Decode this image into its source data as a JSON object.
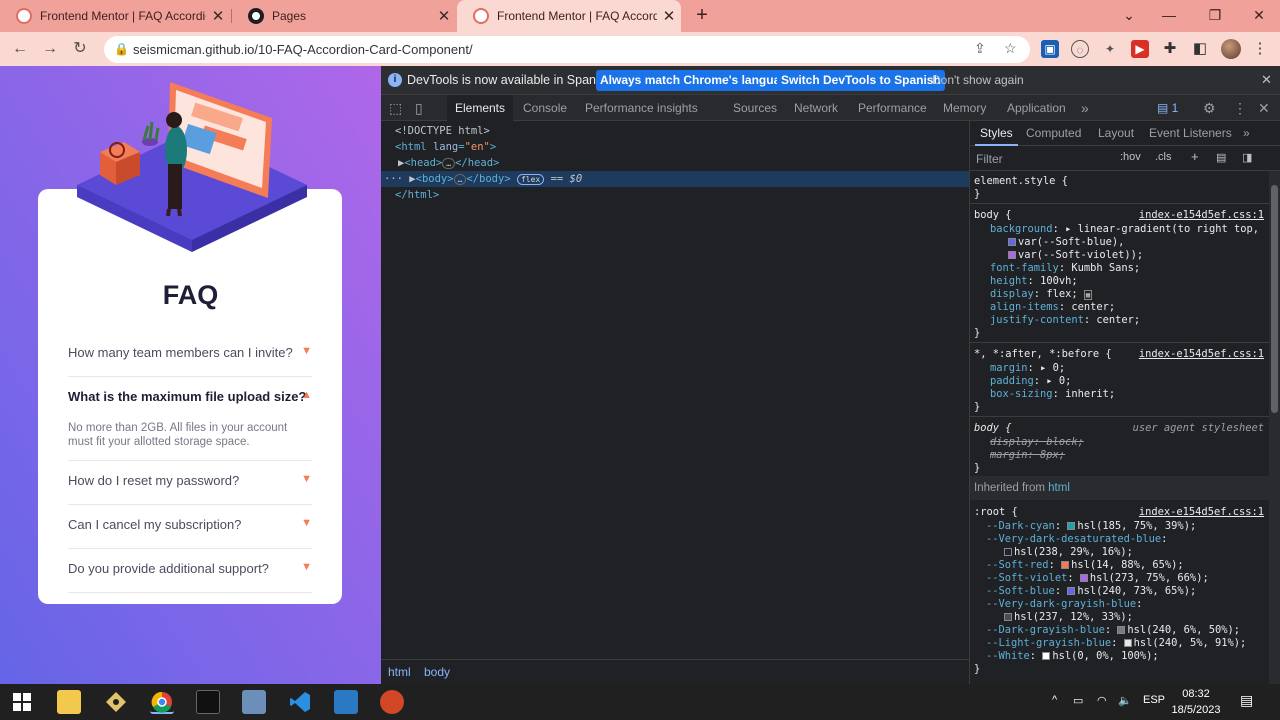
{
  "browser": {
    "tabs": [
      {
        "title": "Frontend Mentor | FAQ Accordion Card"
      },
      {
        "title": "Pages"
      },
      {
        "title": "Frontend Mentor | FAQ Accordion Card"
      }
    ],
    "url": "seismicman.github.io/10-FAQ-Accordion-Card-Component/"
  },
  "page": {
    "title": "FAQ",
    "questions": [
      {
        "q": "How many team members can I invite?"
      },
      {
        "q": "What is the maximum file upload size?"
      },
      {
        "q": "How do I reset my password?"
      },
      {
        "q": "Can I cancel my subscription?"
      },
      {
        "q": "Do you provide additional support?"
      }
    ],
    "open_answer": "No more than 2GB. All files in your account must fit your allotted storage space."
  },
  "devtools": {
    "info_message": "DevTools is now available in Spanish!",
    "info_btn_match": "Always match Chrome's language",
    "info_btn_switch": "Switch DevTools to Spanish",
    "info_btn_dismiss": "Don't show again",
    "tabs": [
      "Elements",
      "Console",
      "Performance insights",
      "Sources",
      "Network",
      "Performance",
      "Memory",
      "Application"
    ],
    "issues_count": "1",
    "dom": {
      "doctype": "<!DOCTYPE html>",
      "html_open": "<html",
      "lang_attr": "lang",
      "lang_val": "\"en\"",
      "head": "<head>",
      "head_close": "</head>",
      "body": "<body>",
      "body_close": "</body>",
      "flex_badge": "flex",
      "dollar": "== $0",
      "html_close": "</html>"
    },
    "breadcrumbs": [
      "html",
      "body"
    ],
    "styles_tabs": [
      "Styles",
      "Computed",
      "Layout",
      "Event Listeners"
    ],
    "filter_placeholder": "Filter",
    "hov": ":hov",
    "cls": ".cls",
    "css": {
      "element_style": "element.style {",
      "close": "}",
      "body_sel": "body {",
      "src1": "index-e154d5ef.css:1",
      "background_prop": "background",
      "background_val": "linear-gradient(to right top,",
      "bg_var1": "var(--Soft-blue),",
      "bg_var2": "var(--Soft-violet));",
      "ff_prop": "font-family",
      "ff_val": "Kumbh Sans;",
      "height_prop": "height",
      "height_val": "100vh;",
      "display_prop": "display",
      "display_val": "flex;",
      "align_prop": "align-items",
      "align_val": "center;",
      "justify_prop": "justify-content",
      "justify_val": "center;",
      "universal_sel": "*, *:after, *:before {",
      "margin_prop": "margin",
      "zero": "0;",
      "padding_prop": "padding",
      "boxsizing_prop": "box-sizing",
      "boxsizing_val": "inherit;",
      "ua_sel": "body {",
      "ua_label": "user agent stylesheet",
      "ua_display": "display: block;",
      "ua_margin": "margin: 8px;",
      "inherited_label": "Inherited from",
      "inherited_link": "html",
      "root_sel": ":root {",
      "vars": [
        {
          "name": "--Dark-cyan",
          "val": "hsl(185, 75%, 39%);",
          "color": "#19a3ae"
        },
        {
          "name": "--Very-dark-desaturated-blue",
          "val": "hsl(238, 29%, 16%);",
          "color": "#1e1f36"
        },
        {
          "name": "--Soft-red",
          "val": "hsl(14, 88%, 65%);",
          "color": "#f47b56"
        },
        {
          "name": "--Soft-violet",
          "val": "hsl(273, 75%, 66%);",
          "color": "#af67e9"
        },
        {
          "name": "--Soft-blue",
          "val": "hsl(240, 73%, 65%);",
          "color": "#6565e7"
        },
        {
          "name": "--Very-dark-grayish-blue",
          "val": "hsl(237, 12%, 33%);",
          "color": "#4a4b5e"
        },
        {
          "name": "--Dark-grayish-blue",
          "val": "hsl(240, 6%, 50%);",
          "color": "#787887"
        },
        {
          "name": "--Light-grayish-blue",
          "val": "hsl(240, 5%, 91%);",
          "color": "#e7e7e9"
        },
        {
          "name": "--White",
          "val": "hsl(0, 0%, 100%);",
          "color": "#ffffff"
        }
      ]
    }
  },
  "taskbar": {
    "lang": "ESP",
    "time": "08:32",
    "date": "18/5/2023"
  }
}
